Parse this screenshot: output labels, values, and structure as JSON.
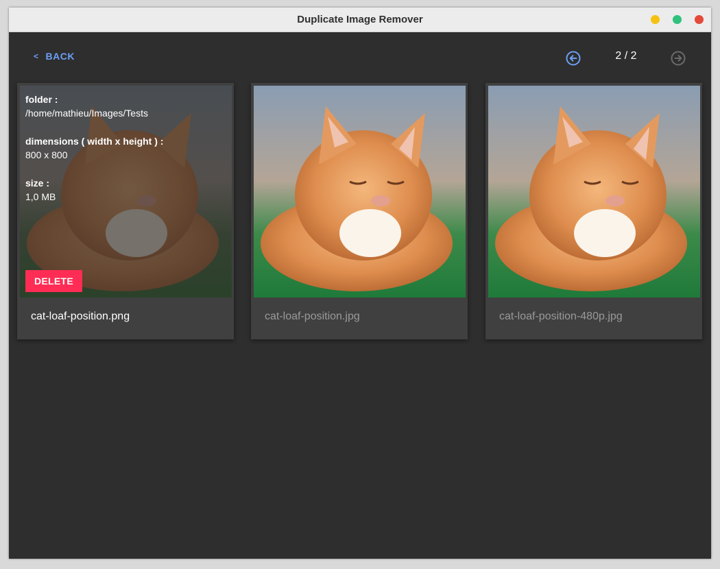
{
  "window": {
    "title": "Duplicate Image Remover"
  },
  "nav": {
    "back_label": "BACK",
    "page_indicator": "2 / 2",
    "prev_icon": "arrow-left-circle-icon",
    "next_icon": "arrow-right-circle-icon"
  },
  "colors": {
    "accent": "#6d9ff5",
    "delete": "#ff2d55",
    "background": "#2e2e2e",
    "card": "#404040"
  },
  "cards": [
    {
      "filename": "cat-loaf-position.png",
      "selected": true,
      "info": {
        "folder_label": "folder :",
        "folder_value": "/home/mathieu/Images/Tests",
        "dimensions_label": "dimensions ( width x height ) :",
        "dimensions_value": "800 x 800",
        "size_label": "size :",
        "size_value": "1,0 MB"
      },
      "delete_label": "DELETE"
    },
    {
      "filename": "cat-loaf-position.jpg",
      "selected": false
    },
    {
      "filename": "cat-loaf-position-480p.jpg",
      "selected": false
    }
  ]
}
